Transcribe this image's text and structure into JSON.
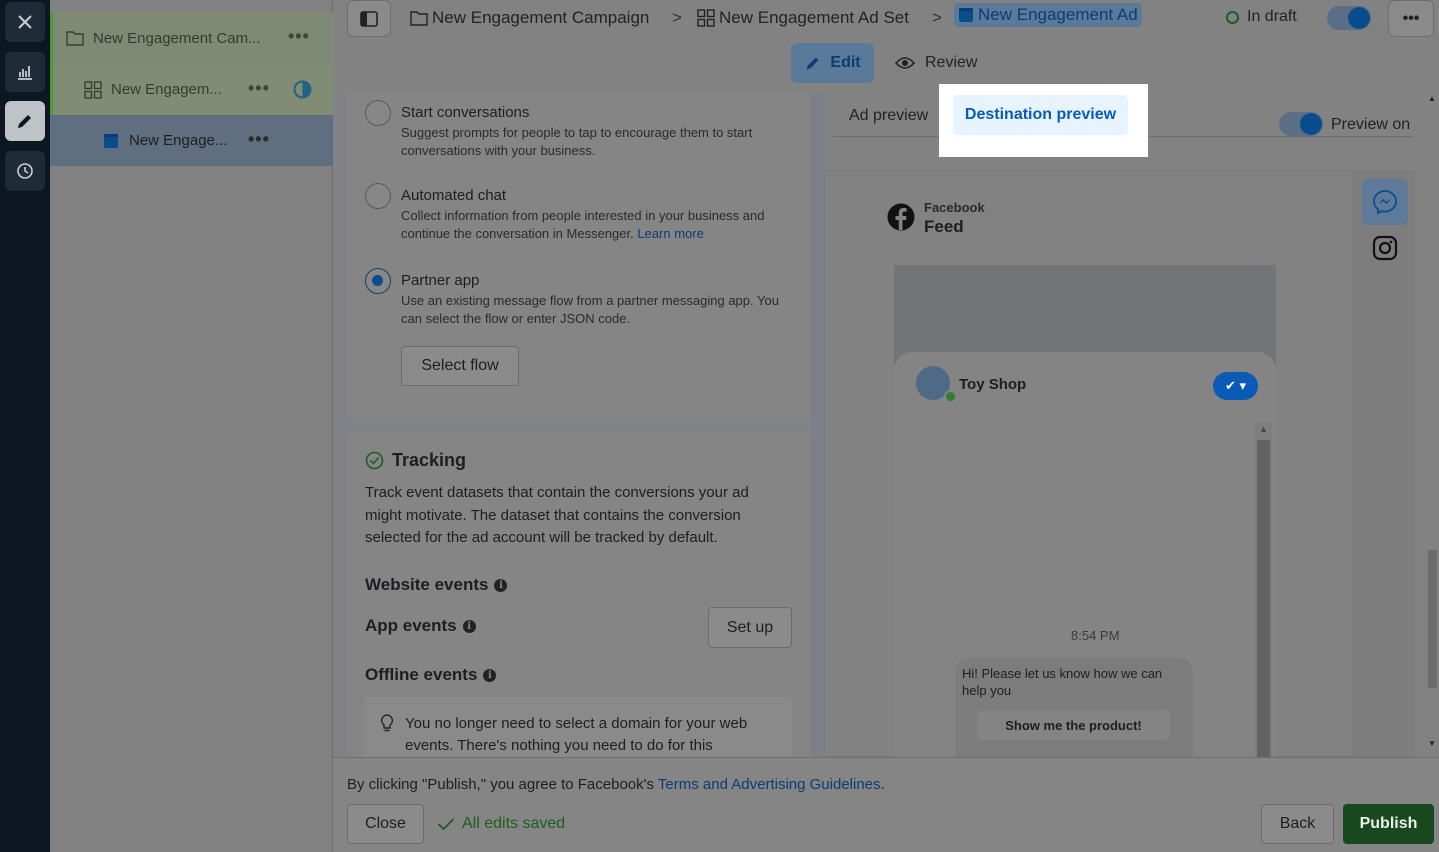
{
  "tree": {
    "campaign": "New Engagement Cam...",
    "adset": "New Engagem...",
    "ad": "New Engage..."
  },
  "breadcrumb": {
    "campaign": "New Engagement Campaign",
    "adset": "New Engagement Ad Set",
    "ad": "New Engagement Ad",
    "sep": ">"
  },
  "status": {
    "label": "In draft"
  },
  "modes": {
    "edit": "Edit",
    "review": "Review"
  },
  "messaging": {
    "options": [
      {
        "title": "Start conversations",
        "desc": "Suggest prompts for people to tap to encourage them to start conversations with your business."
      },
      {
        "title": "Automated chat",
        "desc": "Collect information from people interested in your business and continue the conversation in Messenger.",
        "link": "Learn more"
      },
      {
        "title": "Partner app",
        "desc": "Use an existing message flow from a partner messaging app. You can select the flow or enter JSON code."
      }
    ],
    "selected_index": 2,
    "select_flow": "Select flow"
  },
  "tracking": {
    "title": "Tracking",
    "desc": "Track event datasets that contain the conversions your ad might motivate. The dataset that contains the conversion selected for the ad account will be tracked by default.",
    "website_events": "Website events",
    "app_events": "App events",
    "setup": "Set up",
    "offline_events": "Offline events",
    "tip": "You no longer need to select a domain for your web events. There's nothing you need to do for this"
  },
  "preview": {
    "tab_ad": "Ad preview",
    "tab_destination": "Destination preview",
    "preview_on": "Preview on",
    "platform": "Facebook",
    "placement": "Feed",
    "shop_name": "Toy Shop",
    "time": "8:54 PM",
    "message": "Hi! Please let us know how we can help you",
    "reply_button": "Show me the product!"
  },
  "footer": {
    "agree_prefix": "By clicking \"Publish,\" you agree to Facebook's ",
    "agree_link": "Terms and Advertising Guidelines",
    "agree_suffix": ".",
    "close": "Close",
    "saved": "All edits saved",
    "back": "Back",
    "publish": "Publish"
  },
  "colors": {
    "accent": "#0a5bb5",
    "publish": "#17481e",
    "saved": "#1b5e20"
  }
}
